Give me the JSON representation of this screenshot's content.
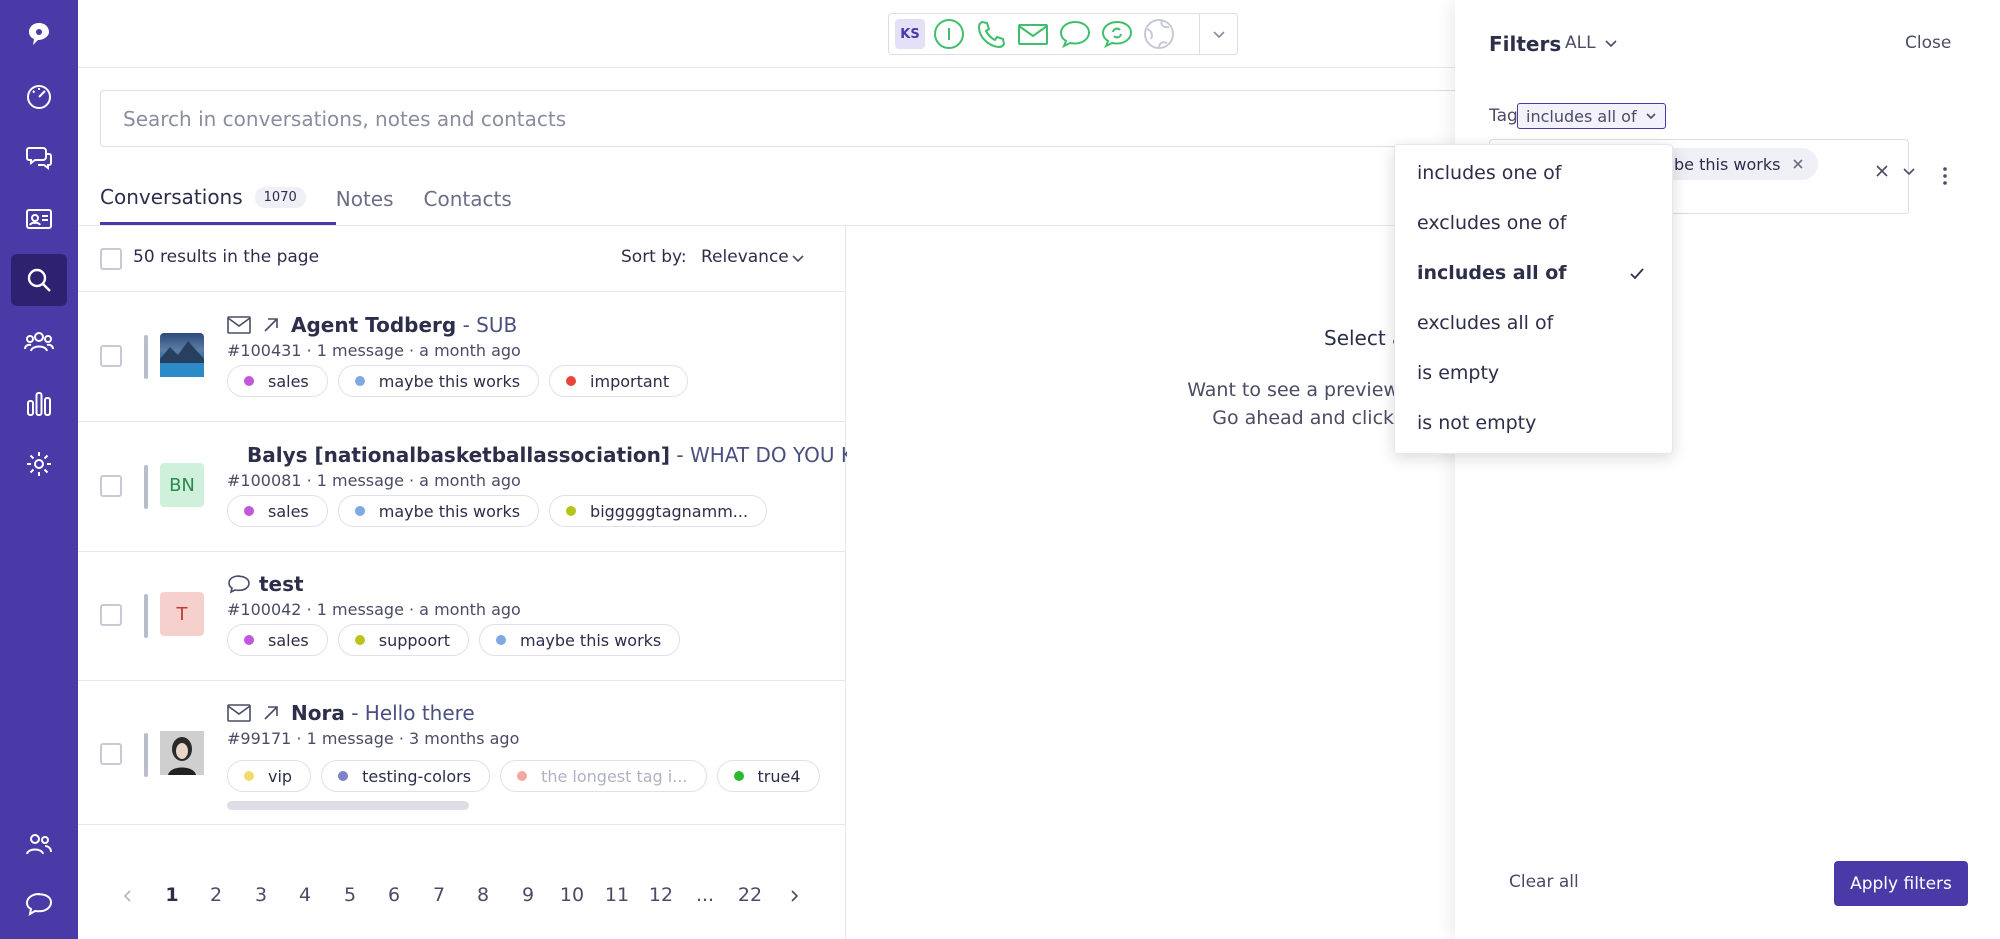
{
  "status": {
    "initials": "KS",
    "icons": [
      "info-icon",
      "phone-icon",
      "mail-icon",
      "chat-icon",
      "chat-refresh-icon",
      "globe-icon"
    ]
  },
  "search": {
    "placeholder": "Search in conversations, notes and contacts"
  },
  "tabs": [
    {
      "label": "Conversations",
      "count": "1070"
    },
    {
      "label": "Notes"
    },
    {
      "label": "Contacts"
    }
  ],
  "list": {
    "results_label": "50 results in the page",
    "sort_label": "Sort by:",
    "sort_value": "Relevance"
  },
  "conversations": [
    {
      "name": "Agent Todberg",
      "subject": " - SUB",
      "meta": "#100431 · 1 message · a month ago",
      "channel": "mail-icon",
      "tags": [
        {
          "label": "sales",
          "color": "#c158dc"
        },
        {
          "label": "maybe this works",
          "color": "#7ea9e1"
        },
        {
          "label": "important",
          "color": "#e8453c"
        }
      ]
    },
    {
      "name": "Balys [nationalbasketballassociation]",
      "subject": " - WHAT DO YOU KNO",
      "meta": "#100081 · 1 message · a month ago",
      "avatar": "BN",
      "channel": "mail-icon",
      "tags": [
        {
          "label": "sales",
          "color": "#c158dc"
        },
        {
          "label": "maybe this works",
          "color": "#7ea9e1"
        },
        {
          "label": "bigggggtagnamm...",
          "color": "#b8c41c"
        }
      ]
    },
    {
      "name": "test",
      "subject": "",
      "meta": "#100042 · 1 message · a month ago",
      "avatar": "T",
      "channel": "chat-icon",
      "tags": [
        {
          "label": "sales",
          "color": "#c158dc"
        },
        {
          "label": "suppoort",
          "color": "#b8c41c"
        },
        {
          "label": "maybe this works",
          "color": "#7ea9e1"
        }
      ]
    },
    {
      "name": "Nora",
      "subject": " - Hello there",
      "meta": "#99171 · 1 message · 3 months ago",
      "channel": "mail-icon",
      "tags": [
        {
          "label": "vip",
          "color": "#f0dc6e"
        },
        {
          "label": "testing-colors",
          "color": "#7a84c8"
        },
        {
          "label": "the longest tag i...",
          "color": "#f4a8a4"
        },
        {
          "label": "true4",
          "color": "#2fb82f"
        }
      ]
    }
  ],
  "pagination": [
    "1",
    "2",
    "3",
    "4",
    "5",
    "6",
    "7",
    "8",
    "9",
    "10",
    "11",
    "12",
    "...",
    "22"
  ],
  "preview": {
    "title": "Select a",
    "line1": "Want to see a preview of t",
    "line2": "Go ahead and click a"
  },
  "filters": {
    "title": "Filters",
    "scope": "ALL",
    "close": "Close",
    "tag_label": "Tag",
    "operator": "includes all of",
    "chip": "be this works",
    "clear_all": "Clear all",
    "apply": "Apply filters"
  },
  "dropdown": [
    "includes one of",
    "excludes one of",
    "includes all of",
    "excludes all of",
    "is empty",
    "is not empty"
  ],
  "colors": {
    "brand": "#4a3aa8",
    "status_green": "#3fbf6a"
  }
}
